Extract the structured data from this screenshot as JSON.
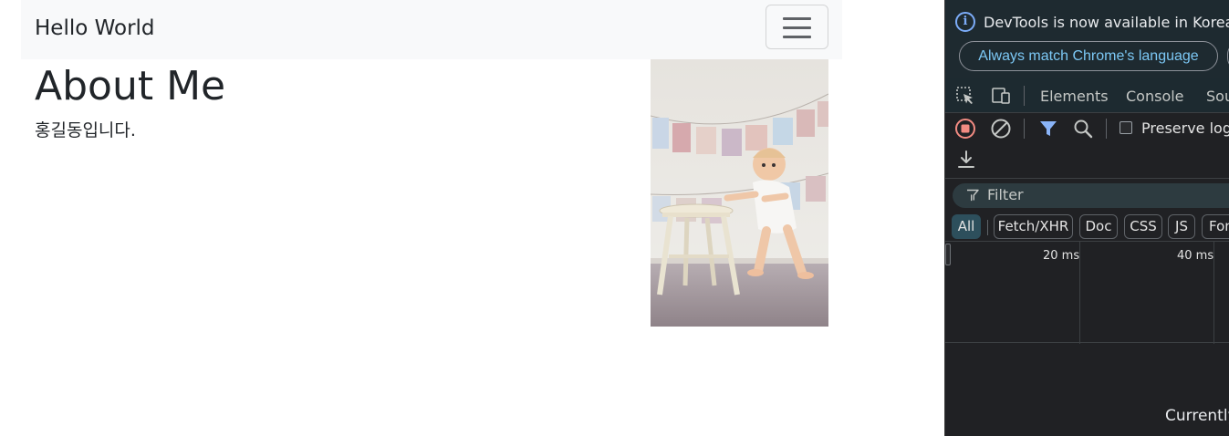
{
  "page": {
    "brand": "Hello World",
    "heading": "About Me",
    "intro": "홍길동입니다."
  },
  "devtools": {
    "info_text": "DevTools is now available in Korean!",
    "language_button": "Always match Chrome's language",
    "tabs": [
      "Elements",
      "Console",
      "Sources"
    ],
    "preserve_log": "Preserve log",
    "filter_placeholder": "Filter",
    "type_filters": [
      "All",
      "Fetch/XHR",
      "Doc",
      "CSS",
      "JS",
      "Font"
    ],
    "timeline_labels": [
      "20 ms",
      "40 ms"
    ],
    "status_text": "Currently",
    "colors": {
      "record_red": "#f28b82",
      "filter_active": "#8ab4f8",
      "link_blue": "#7cc8f5"
    }
  }
}
